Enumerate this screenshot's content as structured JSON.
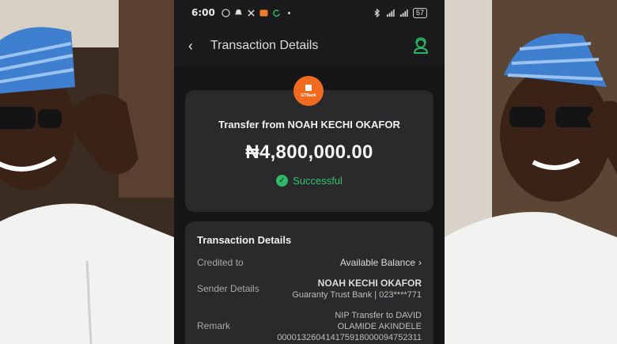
{
  "status_bar": {
    "time": "6:00",
    "battery": "57"
  },
  "app_bar": {
    "title": "Transaction Details"
  },
  "summary": {
    "bank_name": "GTBank",
    "transfer_from": "Transfer from NOAH KECHI OKAFOR",
    "amount": "₦4,800,000.00",
    "status": "Successful"
  },
  "details": {
    "title": "Transaction Details",
    "rows": [
      {
        "label": "Credited to",
        "value": "Available Balance"
      },
      {
        "label": "Sender Details",
        "value": "NOAH KECHI OKAFOR",
        "sub": "Guaranty Trust Bank | 023****771"
      },
      {
        "label": "Remark",
        "value": "NIP Transfer to DAVID",
        "sub": "OLAMIDE AKINDELE",
        "sub2": "000013260414175918000094752311"
      }
    ]
  },
  "colors": {
    "screen_bg": "#1b1b1d",
    "card_bg": "#2a2a2c",
    "success": "#33c16a",
    "bank_brand": "#f06a1f",
    "support_icon": "#28b463"
  }
}
